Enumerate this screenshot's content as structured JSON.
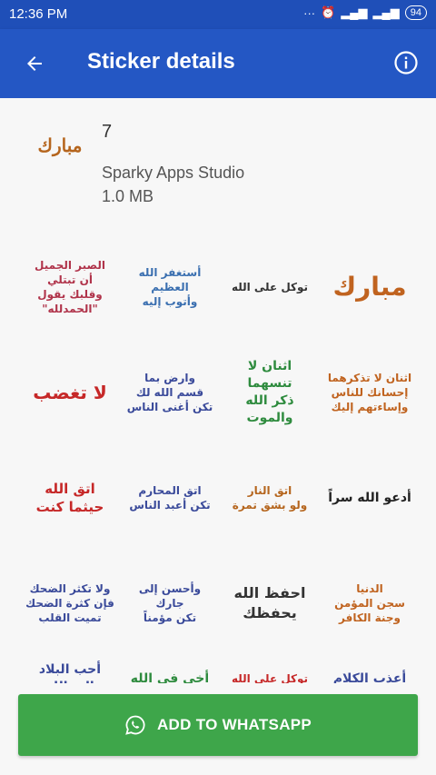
{
  "status_bar": {
    "time": "12:36 PM",
    "battery": "94"
  },
  "app_bar": {
    "title": "Sticker details"
  },
  "pack": {
    "tray_text": "مبارك",
    "name": "7",
    "publisher": "Sparky Apps Studio",
    "size": "1.0 MB"
  },
  "stickers": [
    {
      "text": "الصبر الجميل\nأن تبتلي\nوقلبك يقول\n\"الحمدلله\"",
      "color": "#b0334a"
    },
    {
      "text": "أستغفر الله العظيم\nوأتوب إليه",
      "color": "#3a6fb0"
    },
    {
      "text": "توكل على الله",
      "color": "#333333"
    },
    {
      "text": "مبارك",
      "color": "#c0631f"
    },
    {
      "text": "لا تغضب",
      "color": "#c62828"
    },
    {
      "text": "وارض بما\nقسم الله لك\nتكن أغنى الناس",
      "color": "#3a4a9a"
    },
    {
      "text": "اثنان لا تنسهما\nذكر الله\nوالموت",
      "color": "#2e8b3e"
    },
    {
      "text": "اثنان لا تذكرهما\nإحسانك للناس\nوإساءتهم إليك",
      "color": "#c0631f"
    },
    {
      "text": "اتق الله\nحيثما كنت",
      "color": "#c62828"
    },
    {
      "text": "اتق المحارم\nتكن أعبد الناس",
      "color": "#3a4a9a"
    },
    {
      "text": "اتق النار\nولو بشق تمرة",
      "color": "#b5651d"
    },
    {
      "text": "أدعو الله سراً",
      "color": "#222222"
    },
    {
      "text": "ولا تكثر الضحك\nفإن كثرة الضحك\nتميت القلب",
      "color": "#3a4a9a"
    },
    {
      "text": "وأحسن إلى جارك\nتكن مؤمناً",
      "color": "#3a4a9a"
    },
    {
      "text": "احفظ الله\nيحفظك",
      "color": "#333333"
    },
    {
      "text": "الدنيا\nسجن المؤمن\nوجنة الكافر",
      "color": "#c0631f"
    },
    {
      "text": "أحب البلاد\nإلى الله",
      "color": "#3a4a9a"
    },
    {
      "text": "أخي في الله",
      "color": "#2e8b3e"
    },
    {
      "text": "توكل على الله",
      "color": "#c62828"
    },
    {
      "text": "أعذب الكلام",
      "color": "#3a4a9a"
    }
  ],
  "add_button": {
    "label": "ADD TO WHATSAPP"
  }
}
